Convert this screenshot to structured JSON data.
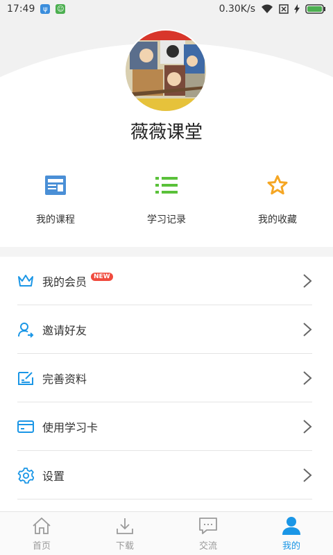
{
  "status_bar": {
    "time": "17:49",
    "network_speed": "0.30K/s"
  },
  "profile": {
    "username": "薇薇课堂"
  },
  "quick_actions": [
    {
      "label": "我的课程",
      "icon": "course-card-icon"
    },
    {
      "label": "学习记录",
      "icon": "list-icon"
    },
    {
      "label": "我的收藏",
      "icon": "star-icon"
    }
  ],
  "menu": [
    {
      "label": "我的会员",
      "badge": "NEW",
      "icon": "crown-icon"
    },
    {
      "label": "邀请好友",
      "icon": "invite-user-icon"
    },
    {
      "label": "完善资料",
      "icon": "edit-profile-icon"
    },
    {
      "label": "使用学习卡",
      "icon": "card-icon"
    },
    {
      "label": "设置",
      "icon": "gear-icon"
    }
  ],
  "tabs": [
    {
      "label": "首页",
      "icon": "home-icon"
    },
    {
      "label": "下载",
      "icon": "download-icon"
    },
    {
      "label": "交流",
      "icon": "chat-icon"
    },
    {
      "label": "我的",
      "icon": "user-icon",
      "active": true
    }
  ],
  "colors": {
    "accent": "#1a96e6",
    "course_icon": "#4a8fd6",
    "list_icon": "#5ac13a",
    "star_icon": "#f5a623",
    "badge": "#f04b3e"
  }
}
